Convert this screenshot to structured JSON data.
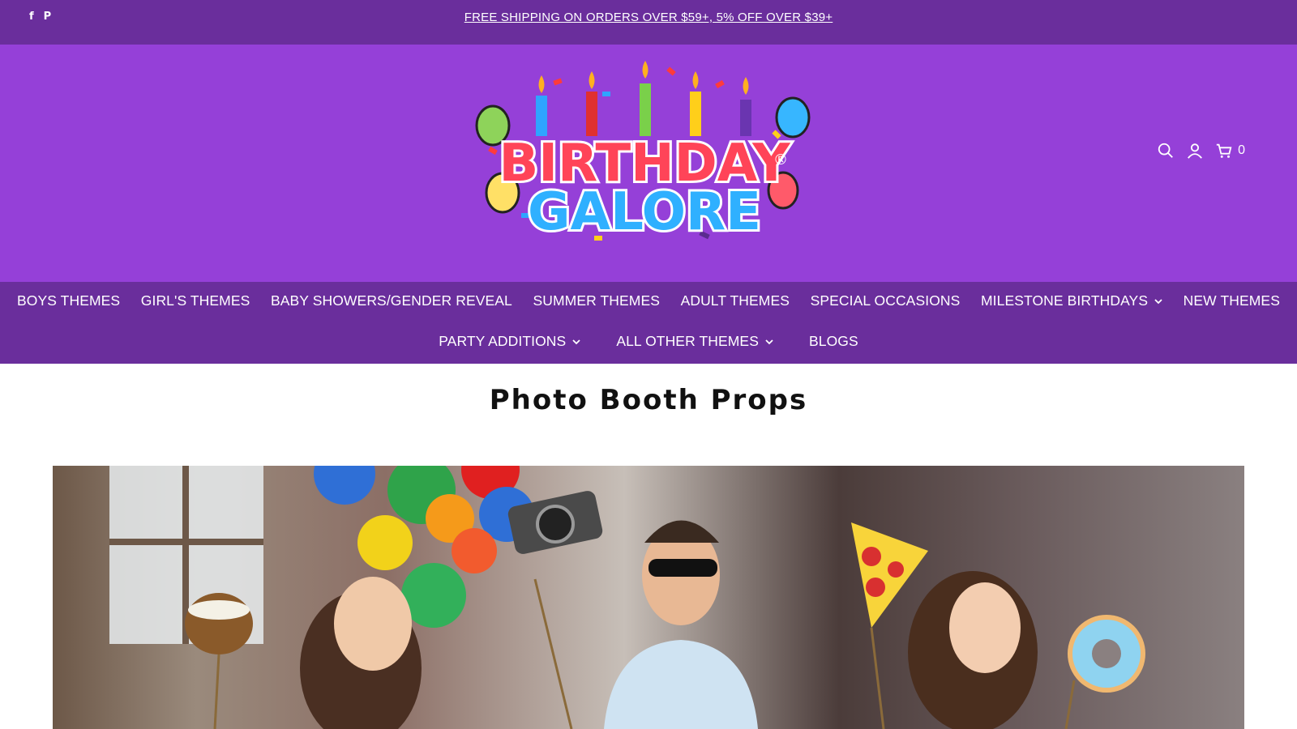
{
  "announcement": {
    "text": "FREE SHIPPING ON ORDERS OVER $59+, 5% OFF OVER $39+",
    "social": [
      {
        "icon": "facebook-icon",
        "glyph": "f"
      },
      {
        "icon": "pinterest-icon",
        "glyph": "P"
      }
    ]
  },
  "header": {
    "logo_line1": "BIRTHDAY",
    "logo_line2": "GALORE",
    "logo_mark": "®",
    "cart_count": "0",
    "icons": [
      "search-icon",
      "account-icon",
      "cart-icon"
    ]
  },
  "nav": {
    "row1": [
      {
        "label": "BOYS THEMES",
        "dropdown": false
      },
      {
        "label": "GIRL'S THEMES",
        "dropdown": false
      },
      {
        "label": "BABY SHOWERS/GENDER REVEAL",
        "dropdown": false
      },
      {
        "label": "SUMMER THEMES",
        "dropdown": false
      },
      {
        "label": "ADULT THEMES",
        "dropdown": false
      },
      {
        "label": "SPECIAL OCCASIONS",
        "dropdown": false
      },
      {
        "label": "MILESTONE BIRTHDAYS",
        "dropdown": true
      },
      {
        "label": "NEW THEMES",
        "dropdown": false
      }
    ],
    "row2": [
      {
        "label": "PARTY ADDITIONS",
        "dropdown": true
      },
      {
        "label": "ALL OTHER THEMES",
        "dropdown": true
      },
      {
        "label": "BLOGS",
        "dropdown": false
      }
    ]
  },
  "page": {
    "title": "Photo Booth Props"
  },
  "colors": {
    "announce_bg": "#6a2e9c",
    "header_bg": "#9540d8",
    "nav_bg": "#6a2e9c",
    "text_light": "#ffffff"
  }
}
